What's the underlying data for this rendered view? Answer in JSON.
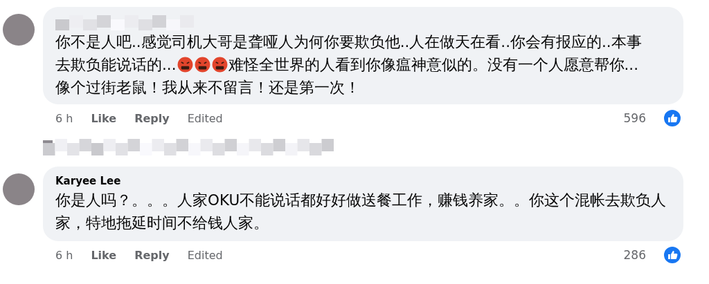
{
  "comments": [
    {
      "lines": [
        [
          {
            "kind": "text",
            "text": "你不是人吧..感觉司机大哥是聋哑人为何你要欺负他..人在做天在看..你会有报应的..本事"
          }
        ],
        [
          {
            "kind": "text",
            "text": "去欺负能说话的..."
          },
          {
            "kind": "emoji"
          },
          {
            "kind": "emoji"
          },
          {
            "kind": "emoji"
          },
          {
            "kind": "text",
            "text": "难怪全世界的人看到你像瘟神意似的。没有一个人愿意帮你..."
          }
        ],
        [
          {
            "kind": "text",
            "text": "像个过街老鼠！我从来不留言！还是第一次！"
          }
        ]
      ],
      "time": "6 h",
      "actions": [
        "Like",
        "Reply",
        "Edited"
      ],
      "reactions": "596"
    },
    {
      "author": "Karyee Lee",
      "lines": [
        [
          {
            "kind": "text",
            "text": "你是人吗？。。。人家OKU不能说话都好好做送餐工作，赚钱养家。。你这个混帐去欺负人"
          }
        ],
        [
          {
            "kind": "text",
            "text": "家，特地拖延时间不给钱人家。"
          }
        ]
      ],
      "time": "6 h",
      "actions": [
        "Like",
        "Reply",
        "Edited"
      ],
      "reactions": "286"
    }
  ]
}
